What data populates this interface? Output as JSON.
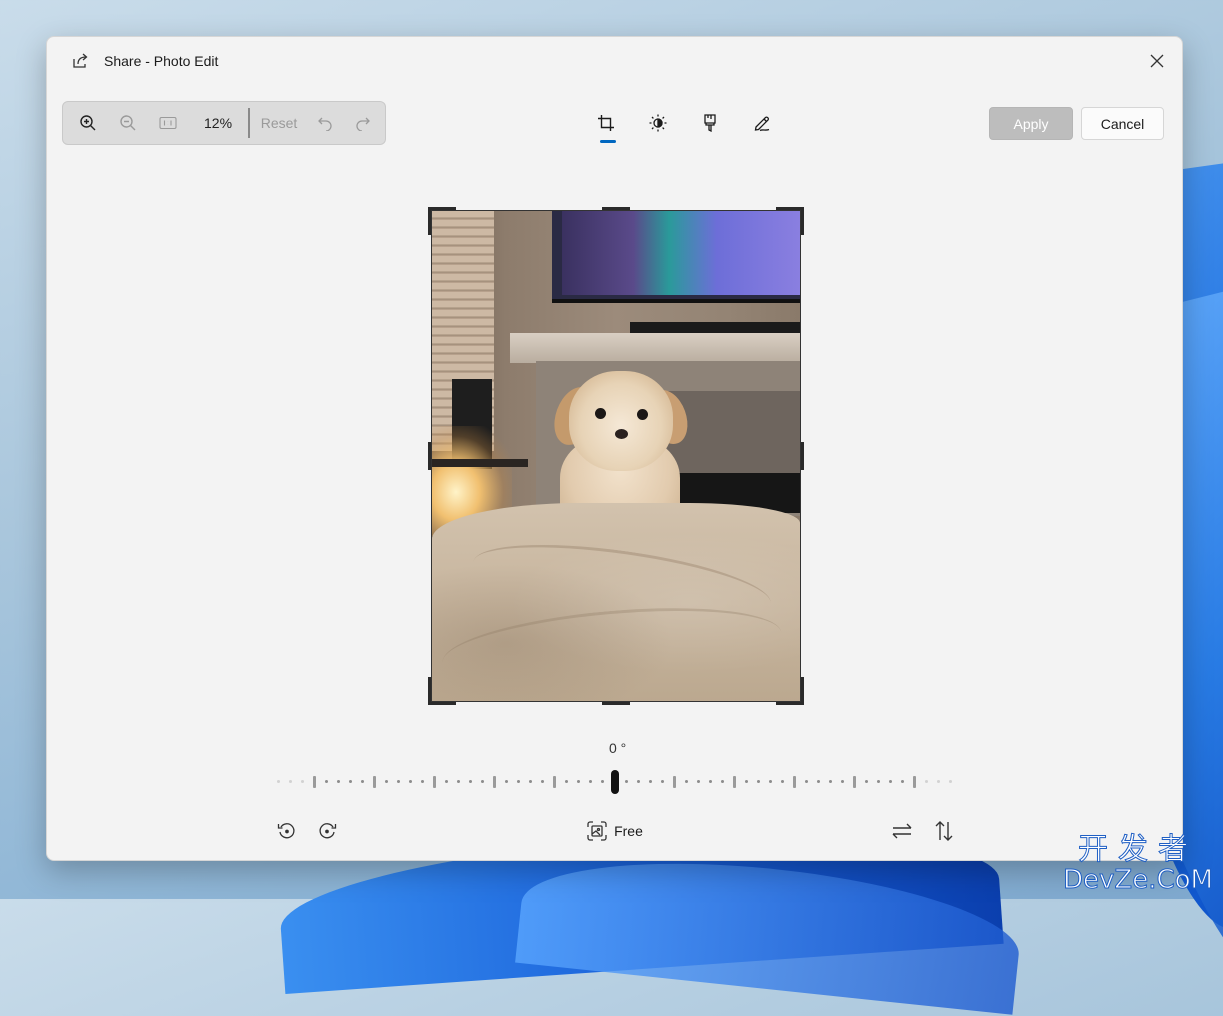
{
  "window": {
    "title": "Share - Photo Edit"
  },
  "toolbar": {
    "zoom_value": "12%",
    "reset_label": "Reset",
    "apply_label": "Apply",
    "cancel_label": "Cancel",
    "icons": [
      "zoom-in-icon",
      "zoom-out-icon",
      "actual-size-icon",
      "undo-icon",
      "redo-icon"
    ],
    "tabs": [
      "crop-icon",
      "adjustment-icon",
      "filter-icon",
      "markup-icon"
    ],
    "active_tab": "crop"
  },
  "crop": {
    "angle_label": "0 °",
    "aspect_label": "Free",
    "icons": [
      "rotate-left-icon",
      "rotate-right-icon",
      "aspect-ratio-icon",
      "flip-horizontal-icon",
      "flip-vertical-icon"
    ]
  },
  "watermark": {
    "line1": "开发者",
    "line2": "DevZe.CoM"
  },
  "colors": {
    "accent": "#0067c0",
    "apply_disabled": "#bdbdbd",
    "window_bg": "#f3f3f3"
  }
}
